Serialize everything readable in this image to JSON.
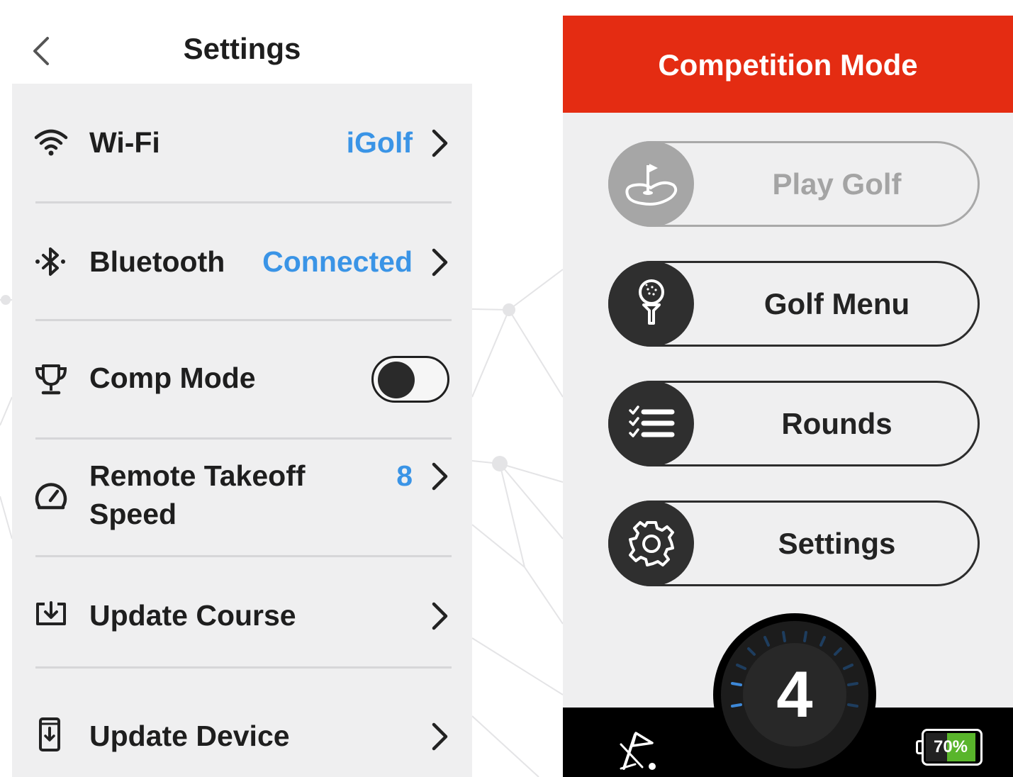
{
  "settings": {
    "title": "Settings",
    "rows": [
      {
        "label": "Wi-Fi",
        "value": "iGolf",
        "icon": "wifi-icon"
      },
      {
        "label": "Bluetooth",
        "value": "Connected",
        "icon": "bluetooth-icon"
      },
      {
        "label": "Comp Mode",
        "icon": "trophy-icon",
        "toggle_on": false
      },
      {
        "label": "Remote Takeoff",
        "label_line2": "Speed",
        "value": "8",
        "icon": "speedometer-icon"
      },
      {
        "label": "Update Course",
        "icon": "download-box-icon"
      },
      {
        "label": "Update Device",
        "icon": "phone-download-icon"
      }
    ]
  },
  "competition": {
    "title": "Competition Mode",
    "menu": [
      {
        "label": "Play Golf",
        "icon": "putting-green-flag-icon",
        "enabled": false
      },
      {
        "label": "Golf Menu",
        "icon": "golf-ball-tee-icon",
        "enabled": true
      },
      {
        "label": "Rounds",
        "icon": "checklist-icon",
        "enabled": true
      },
      {
        "label": "Settings",
        "icon": "gear-icon",
        "enabled": true
      }
    ],
    "dial_value": "4",
    "battery": "70%"
  },
  "colors": {
    "header_red": "#e42c12",
    "accent_blue": "#3a94e6",
    "battery_green": "#59b52b",
    "panel_bg": "#efeff0"
  }
}
